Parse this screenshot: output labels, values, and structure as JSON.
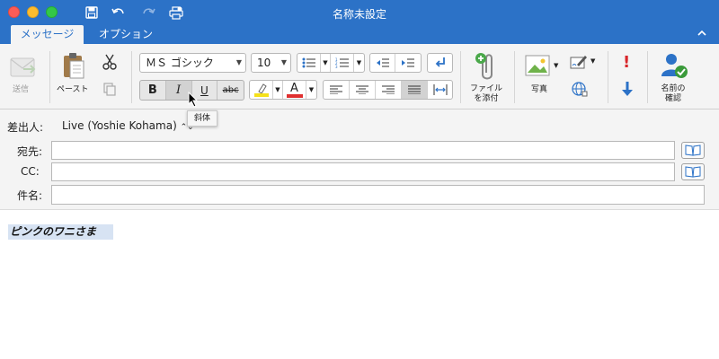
{
  "window": {
    "title": "名称未設定"
  },
  "tabs": {
    "message": "メッセージ",
    "options": "オプション"
  },
  "ribbon": {
    "send": "送信",
    "paste": "ペースト",
    "font_name": "ＭＳ ゴシック",
    "font_size": "10",
    "bold": "B",
    "italic": "I",
    "underline": "U",
    "strike": "abc",
    "font_color_letter": "A",
    "attach_line1": "ファイル",
    "attach_line2": "を添付",
    "photo": "写真",
    "check_names_line1": "名前の",
    "check_names_line2": "確認"
  },
  "tooltip": "斜体",
  "headers": {
    "from_label": "差出人:",
    "from_value": "Live (Yoshie Kohama)",
    "to_label": "宛先:",
    "cc_label": "CC:",
    "subject_label": "件名:"
  },
  "body": {
    "text": "ピンクのワニさま"
  },
  "colors": {
    "accent": "#2c72c7",
    "highlight": "#f5e11a",
    "font_color": "#e03030",
    "selection": "#d7e3f3"
  }
}
